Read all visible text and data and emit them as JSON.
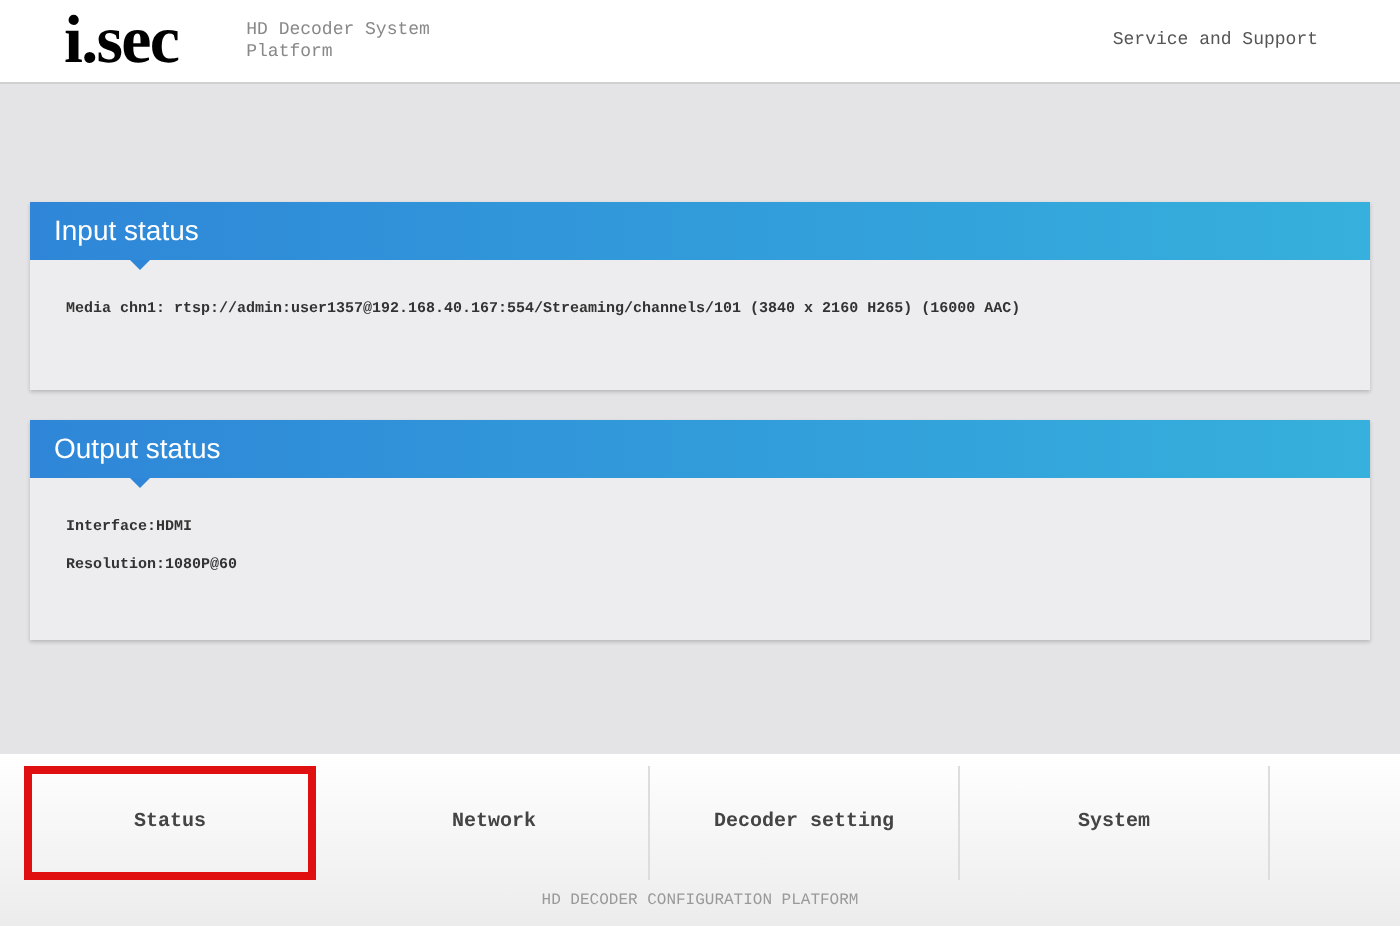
{
  "header": {
    "logo": "i.sec",
    "subtitle": "HD Decoder System Platform",
    "link": "Service and Support"
  },
  "panels": [
    {
      "title": "Input status",
      "lines": [
        "Media chn1: rtsp://admin:user1357@192.168.40.167:554/Streaming/channels/101 (3840 x 2160 H265) (16000 AAC)"
      ]
    },
    {
      "title": "Output status",
      "lines": [
        "Interface:HDMI",
        "Resolution:1080P@60"
      ]
    }
  ],
  "tabs": [
    {
      "label": "Status",
      "selected": true
    },
    {
      "label": "Network",
      "selected": false
    },
    {
      "label": "Decoder setting",
      "selected": false
    },
    {
      "label": "System",
      "selected": false
    }
  ],
  "footer": "HD DECODER CONFIGURATION PLATFORM"
}
